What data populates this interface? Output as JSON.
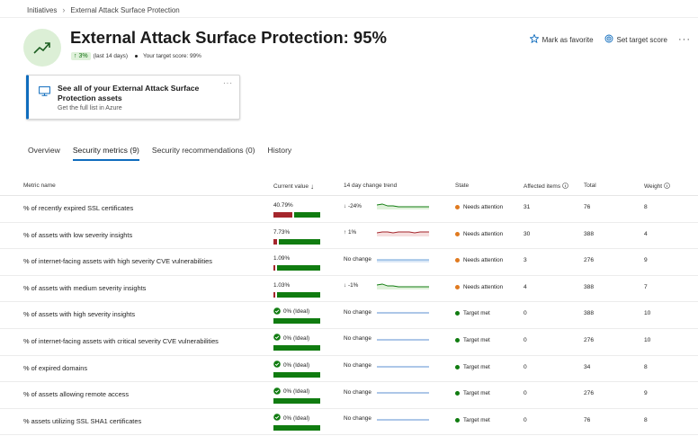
{
  "breadcrumb": [
    "Initiatives",
    "External Attack Surface Protection"
  ],
  "title": "External Attack Surface Protection: 95%",
  "score_change": "3%",
  "score_change_period": "(last 14 days)",
  "target_score_text": "Your target score: 99%",
  "actions": {
    "favorite": "Mark as favorite",
    "set_target": "Set target score",
    "more": "···"
  },
  "card": {
    "title": "See all of your External Attack Surface Protection assets",
    "subtitle": "Get the full list in Azure",
    "more": "···"
  },
  "tabs": [
    {
      "label": "Overview",
      "active": false
    },
    {
      "label": "Security metrics (9)",
      "active": true
    },
    {
      "label": "Security recommendations (0)",
      "active": false
    },
    {
      "label": "History",
      "active": false
    }
  ],
  "columns": {
    "metric": "Metric name",
    "value": "Current value",
    "trend": "14 day change trend",
    "state": "State",
    "affected": "Affected items",
    "total": "Total",
    "weight": "Weight"
  },
  "colors": {
    "accent": "#0f6cbd",
    "good": "#107c10",
    "bad": "#a4262c",
    "attention": "#e07a1f"
  },
  "rows": [
    {
      "metric": "% of recently expired SSL certificates",
      "value": "40.79%",
      "bad_fraction": 0.4079,
      "ideal": false,
      "trend": "-24%",
      "trend_dir": "down",
      "state": "Needs attention",
      "state_kind": "warn",
      "affected": "31",
      "total": "76",
      "weight": "8"
    },
    {
      "metric": "% of assets with low severity insights",
      "value": "7.73%",
      "bad_fraction": 0.0773,
      "ideal": false,
      "trend": "1%",
      "trend_dir": "up",
      "state": "Needs attention",
      "state_kind": "warn",
      "affected": "30",
      "total": "388",
      "weight": "4"
    },
    {
      "metric": "% of internet-facing assets with high severity CVE vulnerabilities",
      "value": "1.09%",
      "bad_fraction": 0.0109,
      "ideal": false,
      "trend": "No change",
      "trend_dir": "none",
      "state": "Needs attention",
      "state_kind": "warn",
      "affected": "3",
      "total": "276",
      "weight": "9"
    },
    {
      "metric": "% of assets with medium severity insights",
      "value": "1.03%",
      "bad_fraction": 0.0103,
      "ideal": false,
      "trend": "-1%",
      "trend_dir": "down",
      "state": "Needs attention",
      "state_kind": "warn",
      "affected": "4",
      "total": "388",
      "weight": "7"
    },
    {
      "metric": "% of assets with high severity insights",
      "value": "0% (Ideal)",
      "bad_fraction": 0,
      "ideal": true,
      "trend": "No change",
      "trend_dir": "none",
      "state": "Target met",
      "state_kind": "ok",
      "affected": "0",
      "total": "388",
      "weight": "10"
    },
    {
      "metric": "% of internet-facing assets with critical severity CVE vulnerabilities",
      "value": "0% (Ideal)",
      "bad_fraction": 0,
      "ideal": true,
      "trend": "No change",
      "trend_dir": "none",
      "state": "Target met",
      "state_kind": "ok",
      "affected": "0",
      "total": "276",
      "weight": "10"
    },
    {
      "metric": "% of expired domains",
      "value": "0% (Ideal)",
      "bad_fraction": 0,
      "ideal": true,
      "trend": "No change",
      "trend_dir": "none",
      "state": "Target met",
      "state_kind": "ok",
      "affected": "0",
      "total": "34",
      "weight": "8"
    },
    {
      "metric": "% of assets allowing remote access",
      "value": "0% (Ideal)",
      "bad_fraction": 0,
      "ideal": true,
      "trend": "No change",
      "trend_dir": "none",
      "state": "Target met",
      "state_kind": "ok",
      "affected": "0",
      "total": "276",
      "weight": "9"
    },
    {
      "metric": "% assets utilizing SSL SHA1 certificates",
      "value": "0% (Ideal)",
      "bad_fraction": 0,
      "ideal": true,
      "trend": "No change",
      "trend_dir": "none",
      "state": "Target met",
      "state_kind": "ok",
      "affected": "0",
      "total": "76",
      "weight": "8"
    }
  ]
}
